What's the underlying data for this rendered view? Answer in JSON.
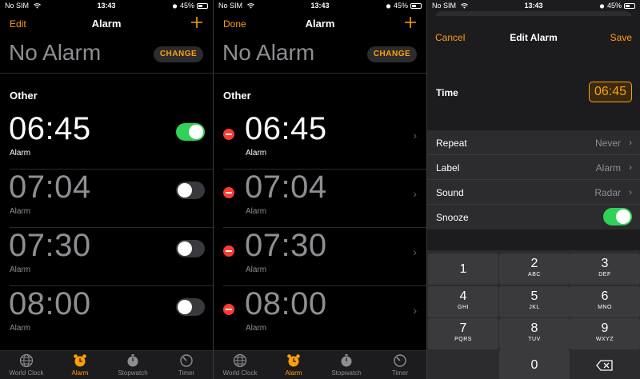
{
  "status": {
    "carrier": "No SIM",
    "time": "13:43",
    "battery": "45%"
  },
  "panel1": {
    "nav_left": "Edit",
    "title": "Alarm",
    "no_alarm": "No Alarm",
    "change": "CHANGE",
    "section": "Other",
    "alarms": [
      {
        "time": "06:45",
        "label": "Alarm",
        "enabled": true
      },
      {
        "time": "07:04",
        "label": "Alarm",
        "enabled": false
      },
      {
        "time": "07:30",
        "label": "Alarm",
        "enabled": false
      },
      {
        "time": "08:00",
        "label": "Alarm",
        "enabled": false
      }
    ]
  },
  "panel2": {
    "nav_left": "Done",
    "title": "Alarm",
    "no_alarm": "No Alarm",
    "change": "CHANGE",
    "section": "Other",
    "alarms": [
      {
        "time": "06:45",
        "label": "Alarm"
      },
      {
        "time": "07:04",
        "label": "Alarm"
      },
      {
        "time": "07:30",
        "label": "Alarm"
      },
      {
        "time": "08:00",
        "label": "Alarm"
      }
    ]
  },
  "tabs": [
    {
      "label": "World Clock",
      "icon": "globe-icon",
      "active": false
    },
    {
      "label": "Alarm",
      "icon": "alarm-clock-icon",
      "active": true
    },
    {
      "label": "Stopwatch",
      "icon": "stopwatch-icon",
      "active": false
    },
    {
      "label": "Timer",
      "icon": "timer-icon",
      "active": false
    }
  ],
  "panel3": {
    "cancel": "Cancel",
    "title": "Edit Alarm",
    "save": "Save",
    "time_label": "Time",
    "time_value": "06:45",
    "settings": [
      {
        "label": "Repeat",
        "value": "Never"
      },
      {
        "label": "Label",
        "value": "Alarm"
      },
      {
        "label": "Sound",
        "value": "Radar"
      },
      {
        "label": "Snooze",
        "value": "",
        "toggle": true
      }
    ]
  },
  "keypad": [
    {
      "num": "1",
      "sub": ""
    },
    {
      "num": "2",
      "sub": "ABC"
    },
    {
      "num": "3",
      "sub": "DEF"
    },
    {
      "num": "4",
      "sub": "GHI"
    },
    {
      "num": "5",
      "sub": "JKL"
    },
    {
      "num": "6",
      "sub": "MNO"
    },
    {
      "num": "7",
      "sub": "PQRS"
    },
    {
      "num": "8",
      "sub": "TUV"
    },
    {
      "num": "9",
      "sub": "WXYZ"
    },
    {
      "num": "0",
      "sub": ""
    }
  ],
  "colors": {
    "accent": "#ff9f0a",
    "toggle_on": "#30d158",
    "delete": "#ff3b30"
  }
}
